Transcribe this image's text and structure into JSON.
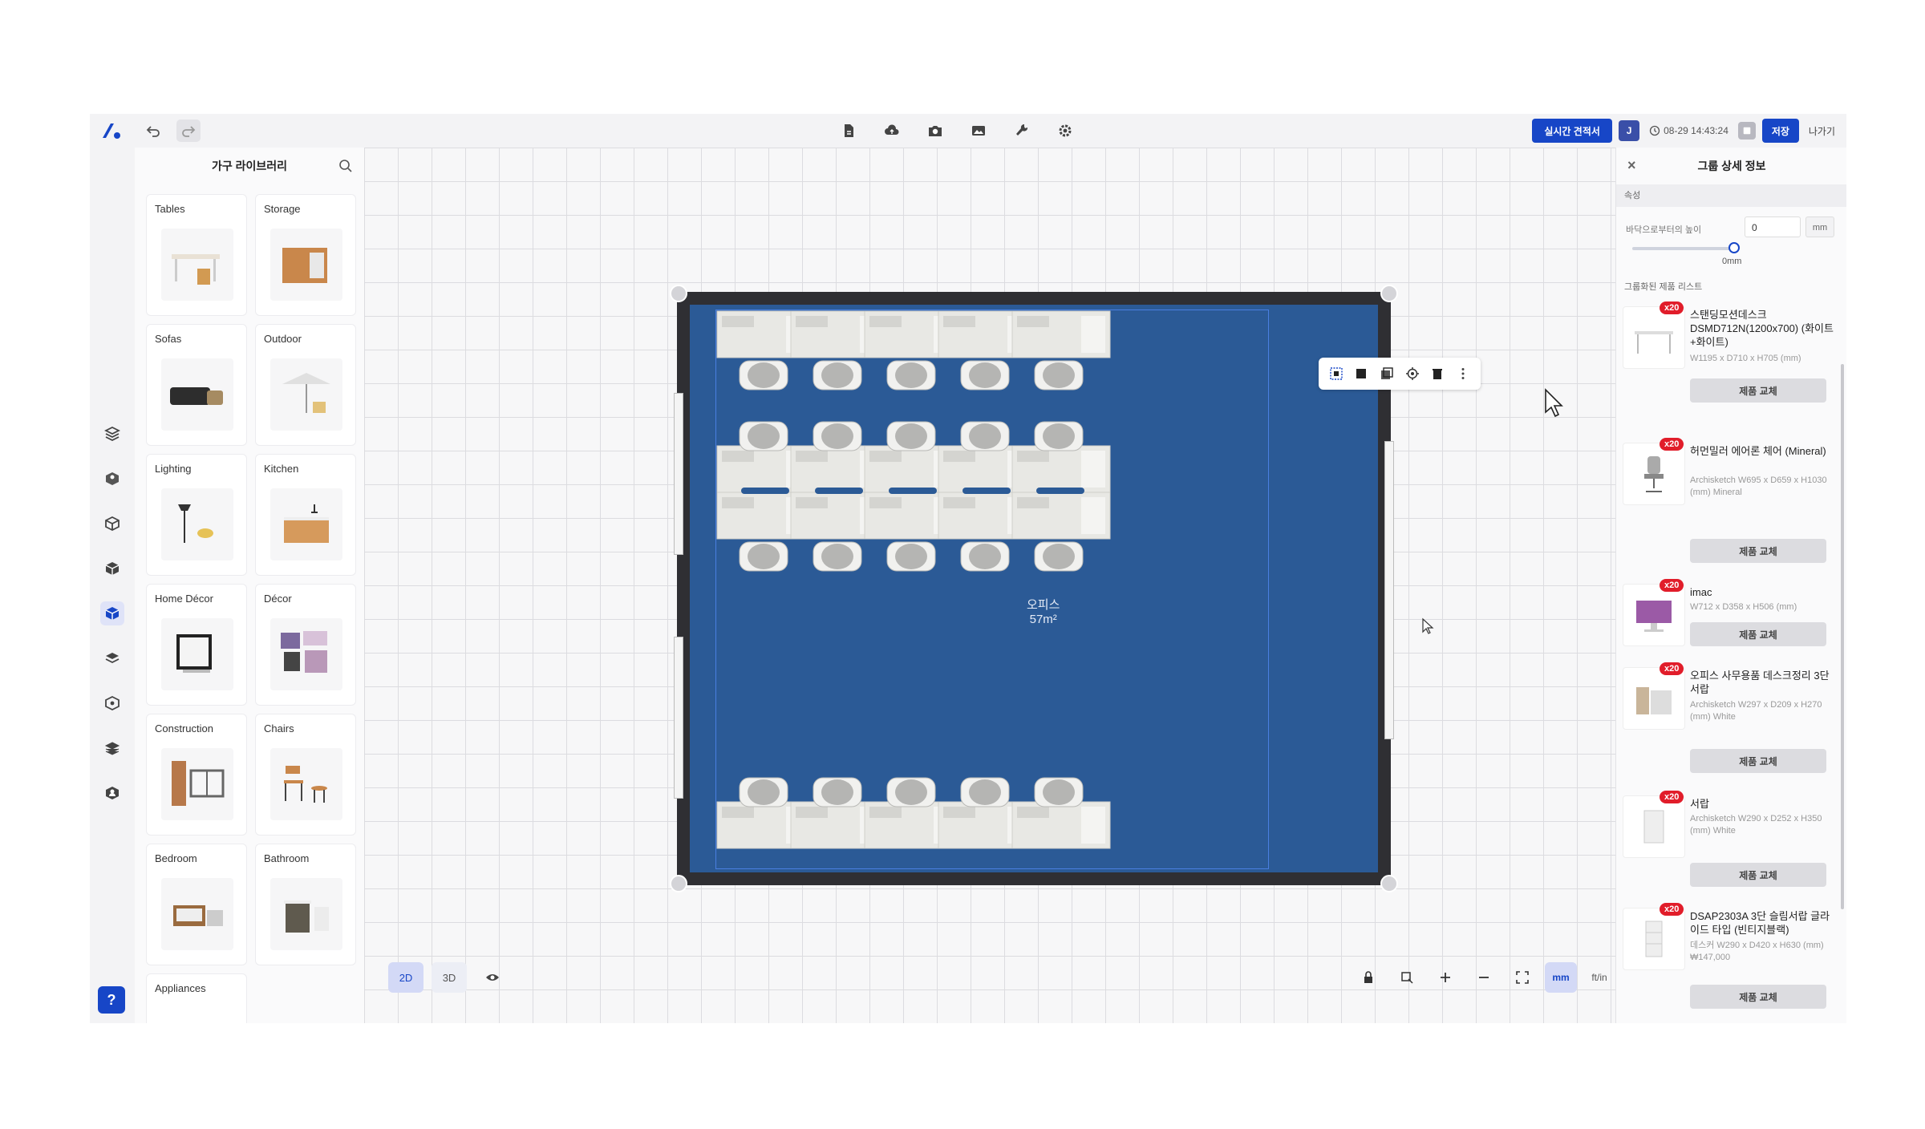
{
  "toolbar": {
    "realtime_quote_label": "실시간 견적서",
    "user_initial": "J",
    "timestamp": "08-29 14:43:24",
    "save_label": "저장",
    "exit_label": "나가기"
  },
  "library": {
    "title": "가구 라이브러리",
    "categories": [
      {
        "label": "Tables"
      },
      {
        "label": "Storage"
      },
      {
        "label": "Sofas"
      },
      {
        "label": "Outdoor"
      },
      {
        "label": "Lighting"
      },
      {
        "label": "Kitchen"
      },
      {
        "label": "Home Décor"
      },
      {
        "label": "Décor"
      },
      {
        "label": "Construction"
      },
      {
        "label": "Chairs"
      },
      {
        "label": "Bedroom"
      },
      {
        "label": "Bathroom"
      },
      {
        "label": "Appliances"
      }
    ]
  },
  "canvas": {
    "room_name": "오피스",
    "room_area": "57m²",
    "view_modes": [
      "2D",
      "3D"
    ],
    "units": [
      "mm",
      "ft/in"
    ],
    "active_unit": "mm"
  },
  "details": {
    "title": "그룹 상세 정보",
    "section_attributes": "속성",
    "floor_height_label": "바닥으로부터의 높이",
    "floor_height_value": "0",
    "floor_height_unit": "mm",
    "slider_value": "0mm",
    "section_products": "그룹화된 제품 리스트",
    "replace_label": "제품 교체",
    "items": [
      {
        "badge": "x20",
        "name": "스탠딩모션데스크 DSMD712N(1200x700) (화이트+화이트)",
        "sub": "W1195 x D710 x H705 (mm)"
      },
      {
        "badge": "x20",
        "name": "허먼밀러 에어론 체어 (Mineral)",
        "sub": "Archisketch W695 x D659 x H1030 (mm) Mineral"
      },
      {
        "badge": "x20",
        "name": "imac",
        "sub": "W712 x D358 x H506 (mm)"
      },
      {
        "badge": "x20",
        "name": "오피스 사무용품 데스크정리 3단서랍",
        "sub": "Archisketch W297 x D209 x H270 (mm) White"
      },
      {
        "badge": "x20",
        "name": "서랍",
        "sub": "Archisketch W290 x D252 x H350 (mm) White"
      },
      {
        "badge": "x20",
        "name": "DSAP2303A 3단 슬림서랍 글라이드 타입 (빈티지블랙)",
        "sub": "데스커 W290 x D420 x H630 (mm) ₩147,000"
      }
    ]
  },
  "colors": {
    "accent": "#1746c7",
    "floor": "#2b5a96",
    "badge": "#e11d2a"
  }
}
